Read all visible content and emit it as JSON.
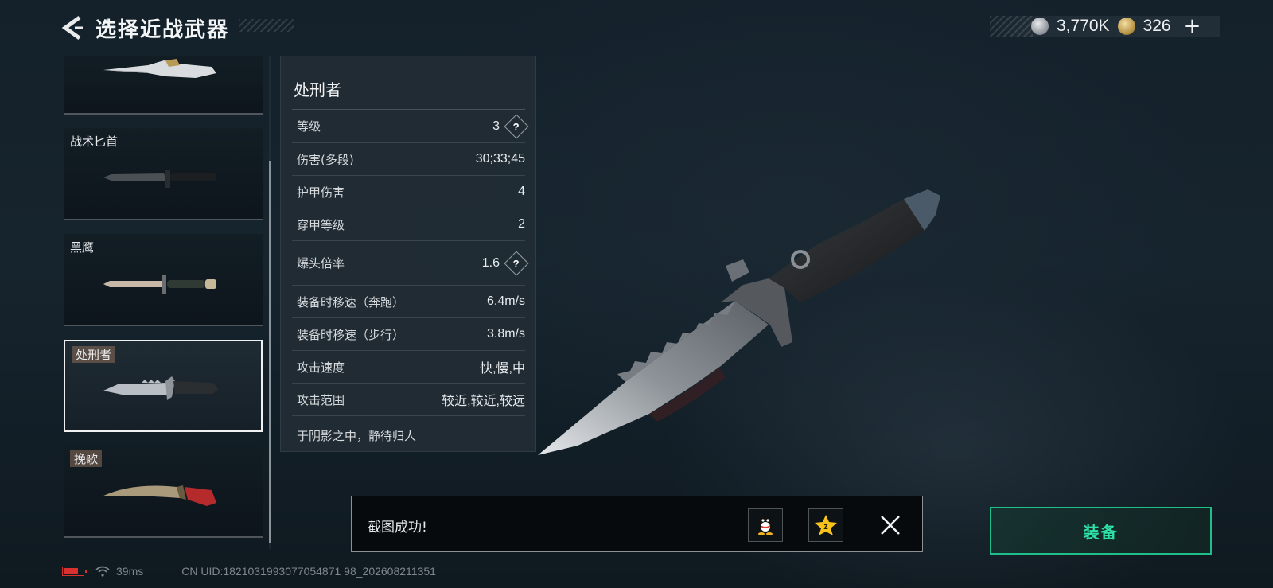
{
  "header": {
    "title": "选择近战武器"
  },
  "currency": {
    "silver_value": "3,770K",
    "gold_value": "326"
  },
  "weapons": [
    {
      "name": ""
    },
    {
      "name": "战术匕首"
    },
    {
      "name": "黑鹰"
    },
    {
      "name": "处刑者"
    },
    {
      "name": "挽歌"
    }
  ],
  "selected_weapon": {
    "name": "处刑者",
    "stats": [
      {
        "label": "等级",
        "value": "3",
        "help": true
      },
      {
        "label": "伤害(多段)",
        "value": "30;33;45",
        "help": false
      },
      {
        "label": "护甲伤害",
        "value": "4",
        "help": false
      },
      {
        "label": "穿甲等级",
        "value": "2",
        "help": false
      },
      {
        "label": "爆头倍率",
        "value": "1.6",
        "help": true
      },
      {
        "label": "装备时移速（奔跑）",
        "value": "6.4m/s",
        "help": false
      },
      {
        "label": "装备时移速（步行）",
        "value": "3.8m/s",
        "help": false
      },
      {
        "label": "攻击速度",
        "value": "快,慢,中",
        "help": false
      },
      {
        "label": "攻击范围",
        "value": "较近,较近,较远",
        "help": false
      }
    ],
    "motto": "于阴影之中，静待归人"
  },
  "toast": {
    "message": "截图成功!"
  },
  "equip_button": {
    "label": "装备"
  },
  "status_bar": {
    "ping": "39ms",
    "uid": "CN UID:1821031993077054871 98_202608211351"
  },
  "colors": {
    "accent_green": "#2fe0a6",
    "battery_red": "#d93030"
  },
  "icons": [
    "back-arrow-icon",
    "silver-coin-icon",
    "gold-coin-icon",
    "plus-icon",
    "help-icon",
    "qq-icon",
    "qzone-icon",
    "close-icon",
    "battery-icon",
    "wifi-icon"
  ]
}
